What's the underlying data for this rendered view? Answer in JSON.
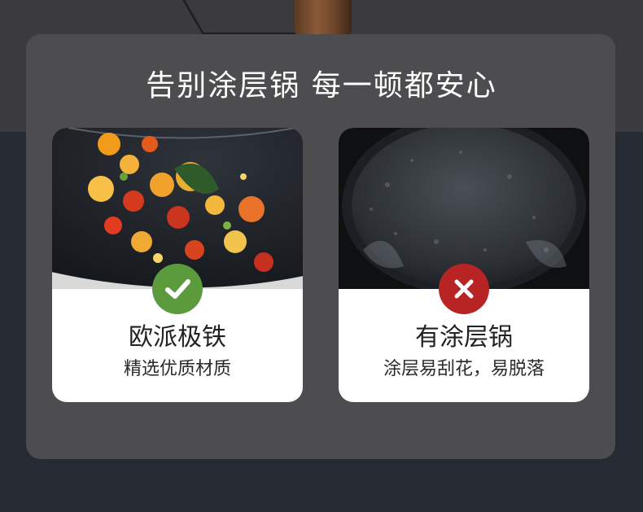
{
  "headline": "告别涂层锅 每一顿都安心",
  "cards": [
    {
      "title": "欧派极铁",
      "subtitle": "精选优质材质",
      "status_icon": "check-icon",
      "status_color": "#5c9a3e"
    },
    {
      "title": "有涂层锅",
      "subtitle": "涂层易刮花，易脱落",
      "status_icon": "x-icon",
      "status_color": "#b82424"
    }
  ]
}
